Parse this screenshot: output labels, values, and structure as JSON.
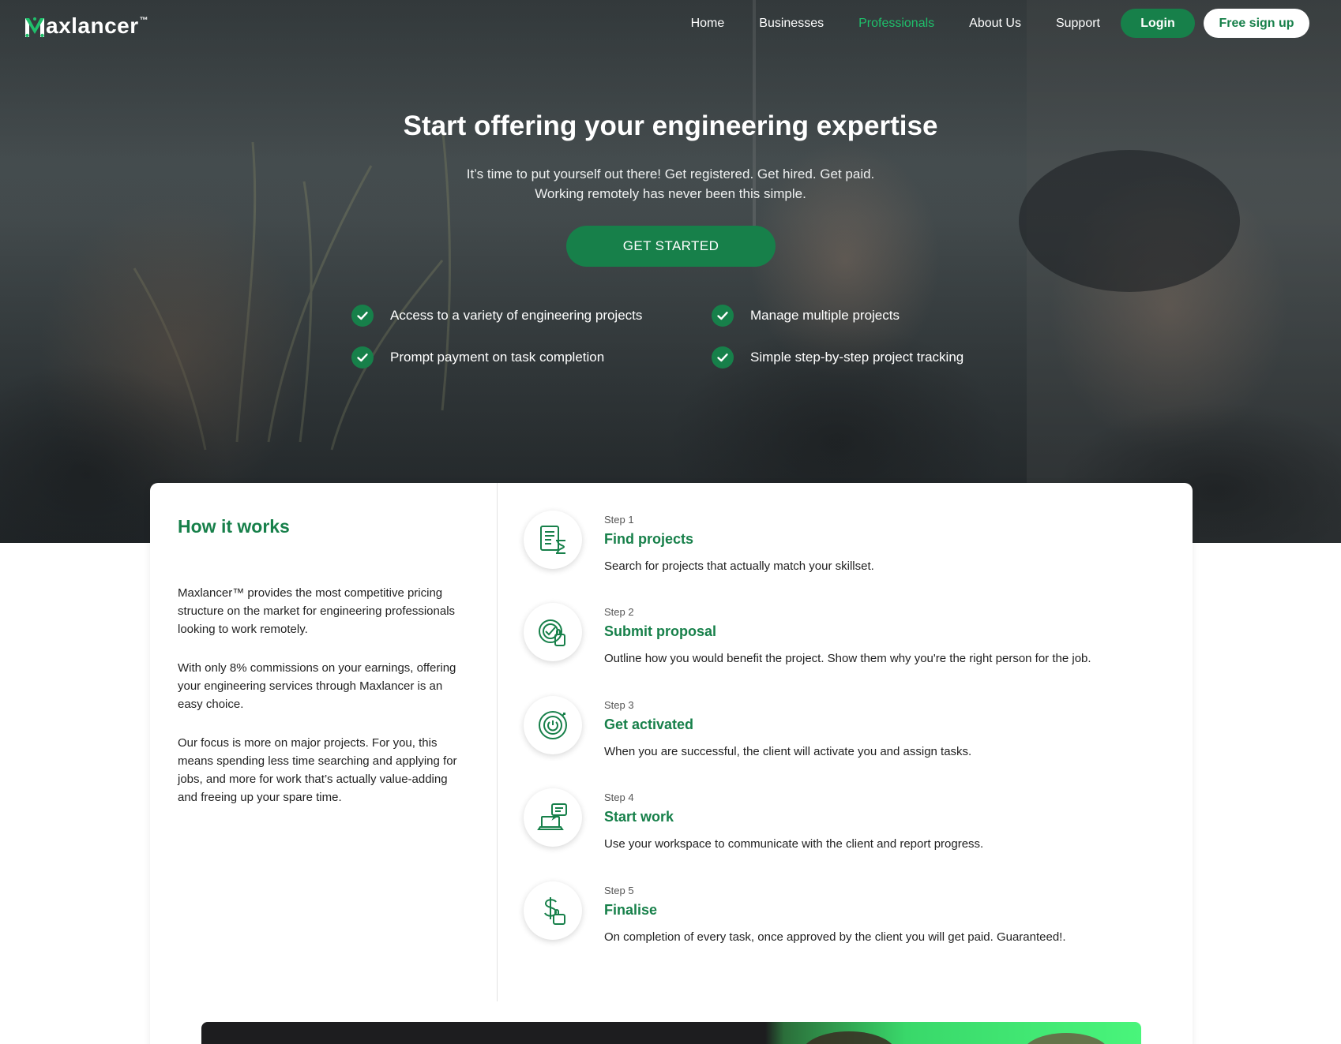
{
  "brand": {
    "name": "axlancer",
    "tm": "™",
    "accent": "#17804a",
    "active_link": "#1fbf6b"
  },
  "nav": {
    "links": [
      {
        "label": "Home"
      },
      {
        "label": "Businesses"
      },
      {
        "label": "Professionals"
      },
      {
        "label": "About Us"
      },
      {
        "label": "Support"
      }
    ],
    "login": "Login",
    "signup": "Free sign up"
  },
  "hero": {
    "title": "Start offering your engineering expertise",
    "subtitle_line1": "It’s time to put yourself out there! Get registered. Get hired. Get paid.",
    "subtitle_line2": "Working remotely has never been this simple.",
    "cta": "GET STARTED",
    "features": [
      "Access to a variety of engineering projects",
      "Manage multiple projects",
      "Prompt payment on task completion",
      "Simple step-by-step project tracking"
    ]
  },
  "how": {
    "title": "How it works",
    "paragraphs": [
      "Maxlancer™ provides the most competitive pricing structure on the market for engineering professionals looking to work remotely.",
      "With only 8% commissions on your earnings, offering your engineering services through Maxlancer is an easy choice.",
      "Our focus is more on major projects. For you, this means spending less time searching and applying for jobs, and more for work that’s actually value-adding and freeing up your spare time."
    ],
    "steps": [
      {
        "num": "Step 1",
        "title": "Find projects",
        "desc": "Search for projects that actually match your skillset.",
        "icon": "document-hourglass-icon"
      },
      {
        "num": "Step 2",
        "title": "Submit proposal",
        "desc": "Outline how you would benefit the project. Show them why you're the right person for the job.",
        "icon": "proposal-check-icon"
      },
      {
        "num": "Step 3",
        "title": "Get activated",
        "desc": "When you are successful, the client will activate you and assign tasks.",
        "icon": "power-activate-icon"
      },
      {
        "num": "Step 4",
        "title": "Start work",
        "desc": "Use your workspace to communicate with the client and report progress.",
        "icon": "laptop-chat-icon"
      },
      {
        "num": "Step 5",
        "title": "Finalise",
        "desc": "On completion of every task, once approved by the client you will get paid. Guaranteed!.",
        "icon": "dollar-payment-icon"
      }
    ]
  }
}
